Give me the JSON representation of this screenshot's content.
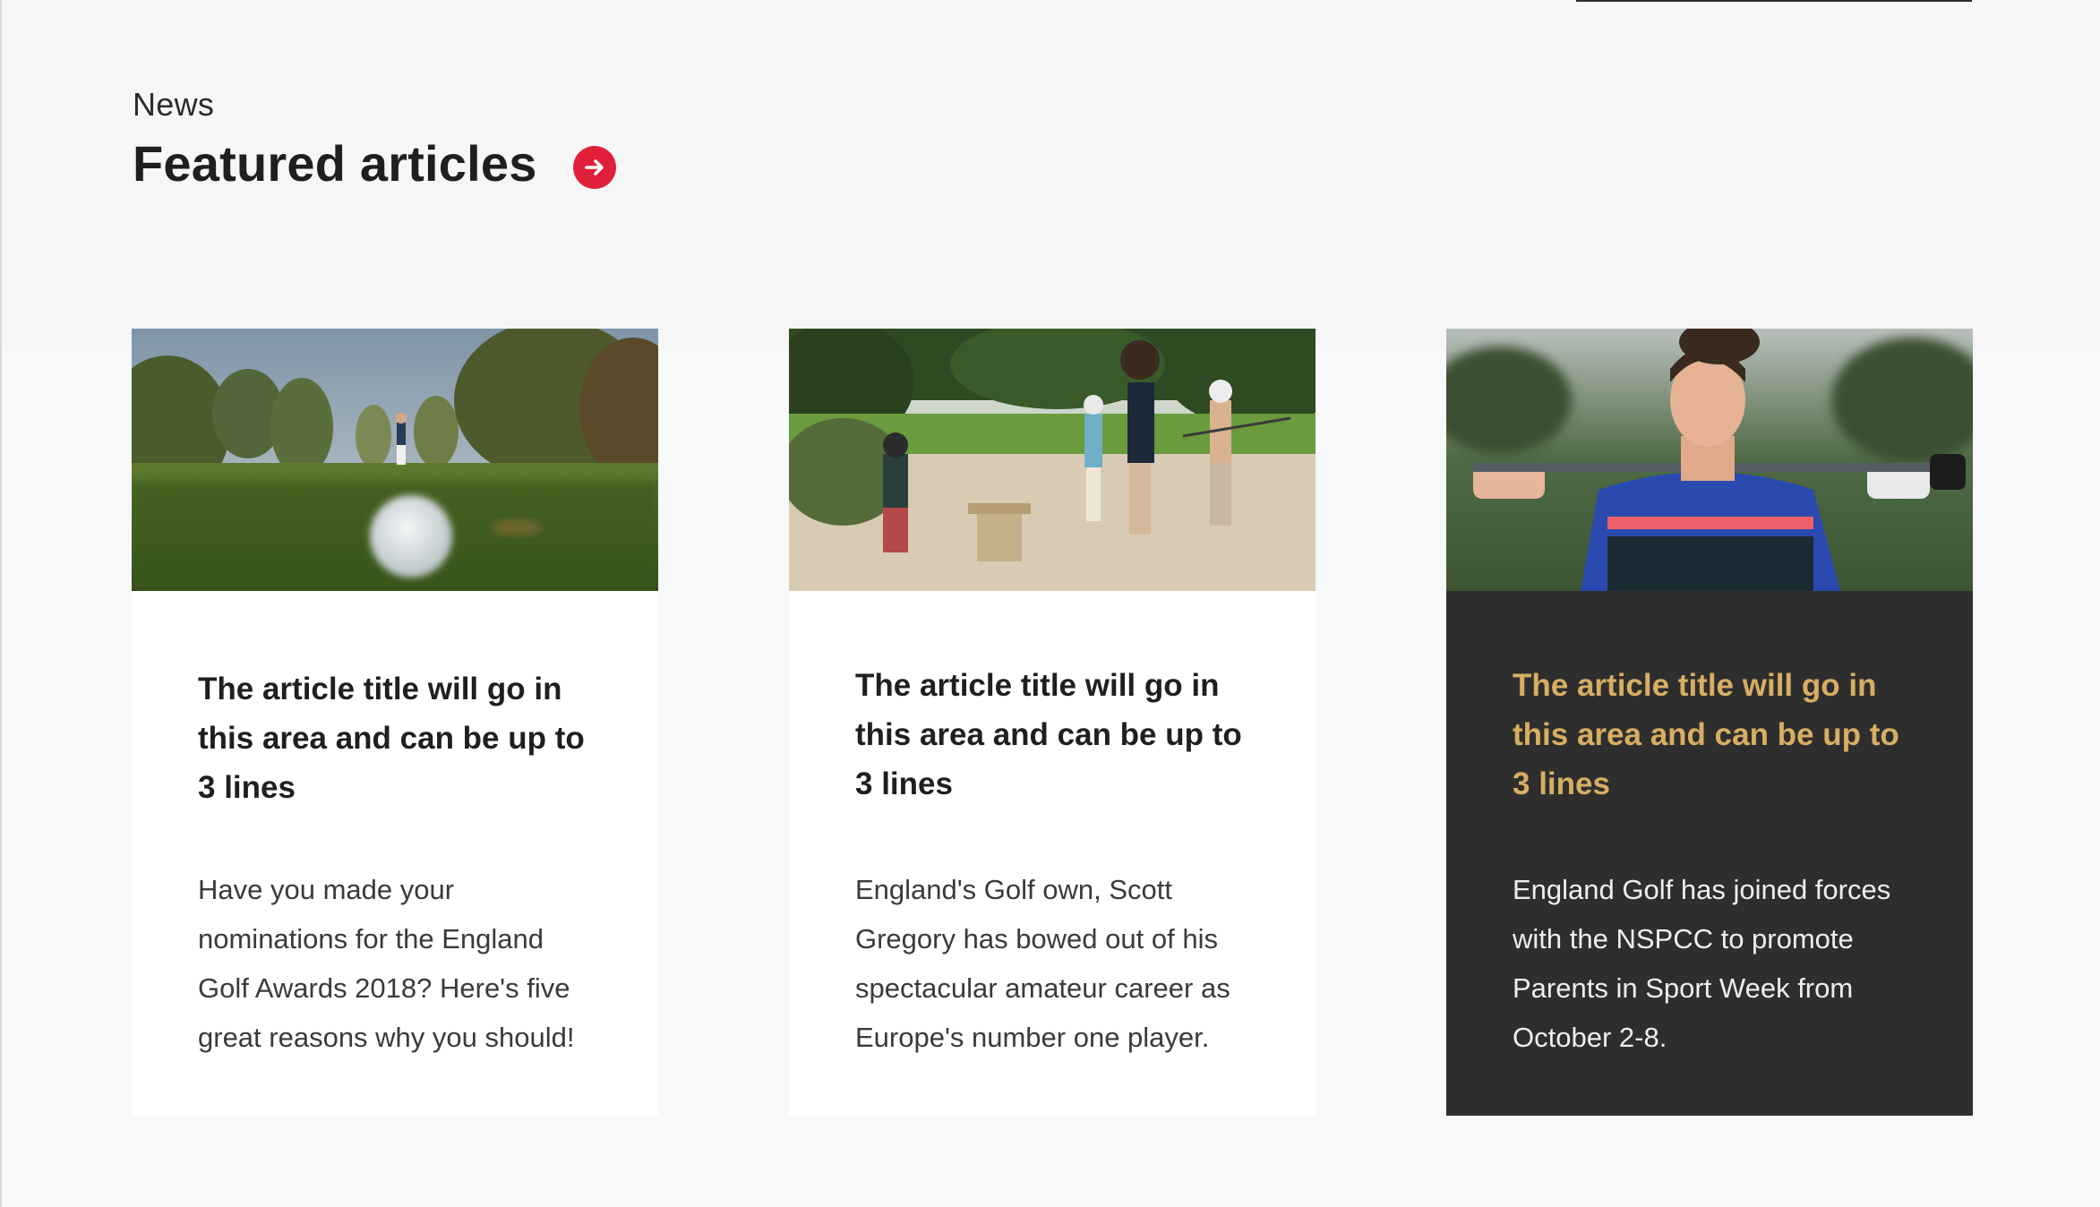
{
  "section": {
    "eyebrow": "News",
    "title": "Featured articles",
    "arrow_icon": "arrow-right-circle-icon",
    "accent_color": "#e0203a"
  },
  "articles": [
    {
      "image": "golf-ball-in-foreground-icon",
      "title": "The article title will go in this area and can be up to 3 lines",
      "excerpt": "Have you made your nominations for the England Golf Awards 2018? Here's five great reasons why you should!",
      "theme": "light"
    },
    {
      "image": "children-in-bunker-icon",
      "title": "The article title will go in this area and can be up to 3 lines",
      "excerpt": "England's Golf own, Scott Gregory has bowed out of his spectacular amateur career as Europe's number one player.",
      "theme": "light"
    },
    {
      "image": "golfer-portrait-icon",
      "title": "The article title will go in this area and can be up to 3 lines",
      "excerpt": "England Golf has joined forces with the NSPCC to promote Parents in Sport Week from October 2-8.",
      "theme": "dark",
      "title_color": "#d8ae62"
    }
  ]
}
